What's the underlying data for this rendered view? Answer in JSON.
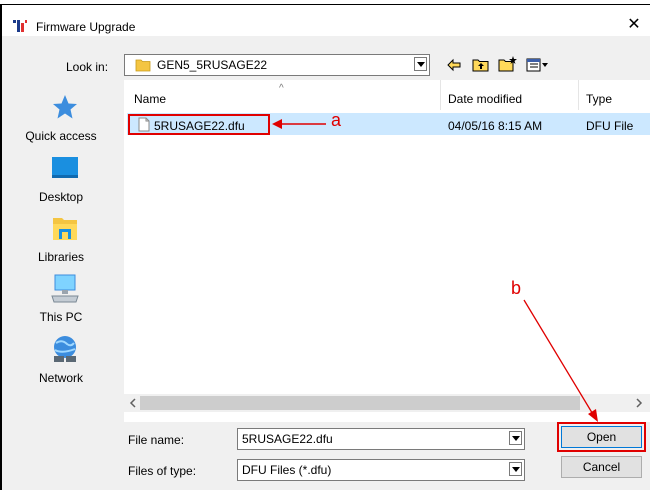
{
  "window": {
    "title": "Firmware Upgrade",
    "close_glyph": "✕"
  },
  "look_in": {
    "label": "Look in:",
    "value": "GEN5_5RUSAGE22"
  },
  "places": [
    {
      "label": "Quick access",
      "icon": "star-icon"
    },
    {
      "label": "Desktop",
      "icon": "desktop-icon"
    },
    {
      "label": "Libraries",
      "icon": "libraries-icon"
    },
    {
      "label": "This PC",
      "icon": "computer-icon"
    },
    {
      "label": "Network",
      "icon": "network-icon"
    }
  ],
  "columns": {
    "name": "Name",
    "date": "Date modified",
    "type": "Type"
  },
  "files": [
    {
      "name": "5RUSAGE22.dfu",
      "date": "04/05/16 8:15 AM",
      "type": "DFU File"
    }
  ],
  "file_name": {
    "label": "File name:",
    "value": "5RUSAGE22.dfu"
  },
  "file_type": {
    "label": "Files of type:",
    "value": "DFU Files (*.dfu)"
  },
  "buttons": {
    "open": "Open",
    "cancel": "Cancel"
  },
  "annotations": {
    "a": "a",
    "b": "b"
  },
  "colors": {
    "highlight": "#e00000",
    "selection": "#cce8ff",
    "accent": "#3c8dde"
  }
}
